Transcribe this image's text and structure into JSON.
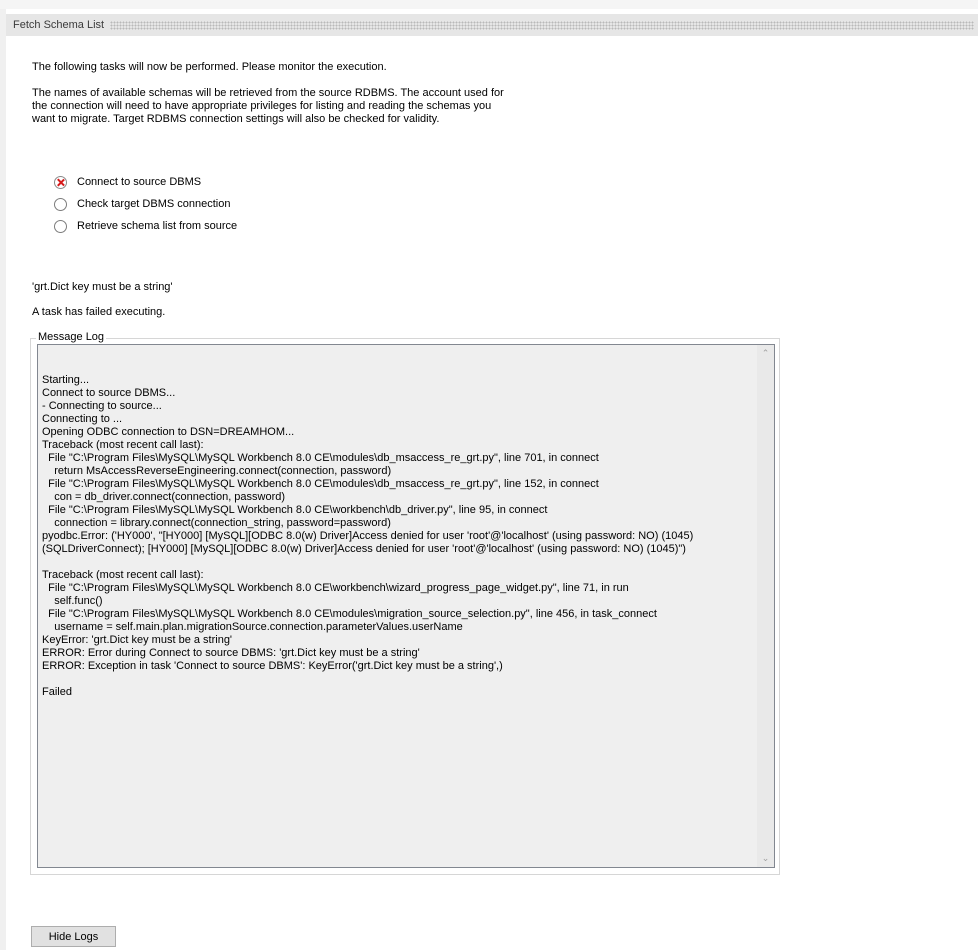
{
  "header": {
    "title": "Fetch Schema List"
  },
  "intro": "The following tasks will now be performed. Please monitor the execution.",
  "description_lines": [
    "The names of available schemas will be retrieved from the source RDBMS. The account used for",
    "the connection will need to have appropriate privileges for listing and reading the schemas you",
    "want to migrate. Target RDBMS connection settings will also be checked for validity."
  ],
  "tasks": [
    {
      "label": "Connect to source DBMS",
      "status": "failed"
    },
    {
      "label": "Check target DBMS connection",
      "status": "pending"
    },
    {
      "label": "Retrieve schema list from source",
      "status": "pending"
    }
  ],
  "error_message": "'grt.Dict key must be a string'",
  "failure_message": "A task has failed executing.",
  "message_log": {
    "label": "Message Log",
    "text": "Starting...\nConnect to source DBMS...\n- Connecting to source...\nConnecting to ...\nOpening ODBC connection to DSN=DREAMHOM...\nTraceback (most recent call last):\n  File \"C:\\Program Files\\MySQL\\MySQL Workbench 8.0 CE\\modules\\db_msaccess_re_grt.py\", line 701, in connect\n    return MsAccessReverseEngineering.connect(connection, password)\n  File \"C:\\Program Files\\MySQL\\MySQL Workbench 8.0 CE\\modules\\db_msaccess_re_grt.py\", line 152, in connect\n    con = db_driver.connect(connection, password)\n  File \"C:\\Program Files\\MySQL\\MySQL Workbench 8.0 CE\\workbench\\db_driver.py\", line 95, in connect\n    connection = library.connect(connection_string, password=password)\npyodbc.Error: ('HY000', \"[HY000] [MySQL][ODBC 8.0(w) Driver]Access denied for user 'root'@'localhost' (using password: NO) (1045)\n(SQLDriverConnect); [HY000] [MySQL][ODBC 8.0(w) Driver]Access denied for user 'root'@'localhost' (using password: NO) (1045)\")\n\nTraceback (most recent call last):\n  File \"C:\\Program Files\\MySQL\\MySQL Workbench 8.0 CE\\workbench\\wizard_progress_page_widget.py\", line 71, in run\n    self.func()\n  File \"C:\\Program Files\\MySQL\\MySQL Workbench 8.0 CE\\modules\\migration_source_selection.py\", line 456, in task_connect\n    username = self.main.plan.migrationSource.connection.parameterValues.userName\nKeyError: 'grt.Dict key must be a string'\nERROR: Error during Connect to source DBMS: 'grt.Dict key must be a string'\nERROR: Exception in task 'Connect to source DBMS': KeyError('grt.Dict key must be a string',)\n\nFailed"
  },
  "buttons": {
    "hide_logs": "Hide Logs"
  }
}
